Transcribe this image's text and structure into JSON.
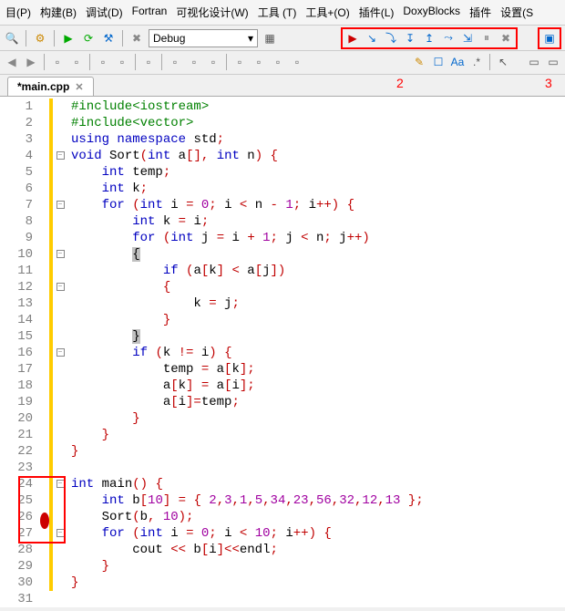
{
  "menu": {
    "items": [
      "目(P)",
      "构建(B)",
      "调试(D)",
      "Fortran",
      "可视化设计(W)",
      "工具 (T)",
      "工具+(O)",
      "插件(L)",
      "DoxyBlocks",
      "插件",
      "设置(S"
    ]
  },
  "toolbar1": {
    "config_label": "Debug",
    "config_dropdown_char": "▾"
  },
  "annotations": {
    "label2": "2",
    "label3": "3"
  },
  "tab": {
    "title": "*main.cpp",
    "close": "✕"
  },
  "code": {
    "lines": [
      {
        "n": 1,
        "change": true,
        "fold": "",
        "html": "<span class='pp'>#include&lt;iostream&gt;</span>"
      },
      {
        "n": 2,
        "change": true,
        "fold": "",
        "html": "<span class='pp'>#include&lt;vector&gt;</span>"
      },
      {
        "n": 3,
        "change": true,
        "fold": "",
        "html": "<span class='kw'>using</span> <span class='kw'>namespace</span> std<span class='op'>;</span>"
      },
      {
        "n": 4,
        "change": true,
        "fold": "box",
        "html": "<span class='kw'>void</span> Sort<span class='op'>(</span><span class='kw'>int</span> a<span class='op'>[],</span> <span class='kw'>int</span> n<span class='op'>)</span> <span class='op'>{</span>"
      },
      {
        "n": 5,
        "change": true,
        "fold": "",
        "html": "    <span class='kw'>int</span> temp<span class='op'>;</span>"
      },
      {
        "n": 6,
        "change": true,
        "fold": "",
        "html": "    <span class='kw'>int</span> k<span class='op'>;</span>"
      },
      {
        "n": 7,
        "change": true,
        "fold": "box",
        "html": "    <span class='kw'>for</span> <span class='op'>(</span><span class='kw'>int</span> i <span class='op'>=</span> <span class='num'>0</span><span class='op'>;</span> i <span class='op'>&lt;</span> n <span class='op'>-</span> <span class='num'>1</span><span class='op'>;</span> i<span class='op'>++)</span> <span class='op'>{</span>"
      },
      {
        "n": 8,
        "change": true,
        "fold": "",
        "html": "        <span class='kw'>int</span> k <span class='op'>=</span> i<span class='op'>;</span>"
      },
      {
        "n": 9,
        "change": true,
        "fold": "",
        "html": "        <span class='kw'>for</span> <span class='op'>(</span><span class='kw'>int</span> j <span class='op'>=</span> i <span class='op'>+</span> <span class='num'>1</span><span class='op'>;</span> j <span class='op'>&lt;</span> n<span class='op'>;</span> j<span class='op'>++)</span>"
      },
      {
        "n": 10,
        "change": true,
        "fold": "box",
        "html": "        <span class='curbrace'>{</span>"
      },
      {
        "n": 11,
        "change": true,
        "fold": "",
        "html": "            <span class='kw'>if</span> <span class='op'>(</span>a<span class='op'>[</span>k<span class='op'>]</span> <span class='op'>&lt;</span> a<span class='op'>[</span>j<span class='op'>])</span>"
      },
      {
        "n": 12,
        "change": true,
        "fold": "box",
        "html": "            <span class='op'>{</span>"
      },
      {
        "n": 13,
        "change": true,
        "fold": "",
        "html": "                k <span class='op'>=</span> j<span class='op'>;</span>"
      },
      {
        "n": 14,
        "change": true,
        "fold": "",
        "html": "            <span class='op'>}</span>"
      },
      {
        "n": 15,
        "change": true,
        "fold": "",
        "html": "        <span class='curbrace'>}</span>"
      },
      {
        "n": 16,
        "change": true,
        "fold": "box",
        "html": "        <span class='kw'>if</span> <span class='op'>(</span>k <span class='op'>!=</span> i<span class='op'>)</span> <span class='op'>{</span>"
      },
      {
        "n": 17,
        "change": true,
        "fold": "",
        "html": "            temp <span class='op'>=</span> a<span class='op'>[</span>k<span class='op'>];</span>"
      },
      {
        "n": 18,
        "change": true,
        "fold": "",
        "html": "            a<span class='op'>[</span>k<span class='op'>]</span> <span class='op'>=</span> a<span class='op'>[</span>i<span class='op'>];</span>"
      },
      {
        "n": 19,
        "change": true,
        "fold": "",
        "html": "            a<span class='op'>[</span>i<span class='op'>]=</span>temp<span class='op'>;</span>"
      },
      {
        "n": 20,
        "change": true,
        "fold": "",
        "html": "        <span class='op'>}</span>"
      },
      {
        "n": 21,
        "change": true,
        "fold": "",
        "html": "    <span class='op'>}</span>"
      },
      {
        "n": 22,
        "change": true,
        "fold": "",
        "html": "<span class='op'>}</span>"
      },
      {
        "n": 23,
        "change": true,
        "fold": "",
        "html": ""
      },
      {
        "n": 24,
        "change": true,
        "fold": "box",
        "html": "<span class='kw'>int</span> main<span class='op'>()</span> <span class='op'>{</span>"
      },
      {
        "n": 25,
        "change": true,
        "fold": "",
        "html": "    <span class='kw'>int</span> b<span class='op'>[</span><span class='num'>10</span><span class='op'>]</span> <span class='op'>=</span> <span class='op'>{</span> <span class='num'>2</span><span class='op'>,</span><span class='num'>3</span><span class='op'>,</span><span class='num'>1</span><span class='op'>,</span><span class='num'>5</span><span class='op'>,</span><span class='num'>34</span><span class='op'>,</span><span class='num'>23</span><span class='op'>,</span><span class='num'>56</span><span class='op'>,</span><span class='num'>32</span><span class='op'>,</span><span class='num'>12</span><span class='op'>,</span><span class='num'>13</span> <span class='op'>};</span>"
      },
      {
        "n": 26,
        "change": true,
        "fold": "",
        "bp": true,
        "html": "    Sort<span class='op'>(</span>b<span class='op'>,</span> <span class='num'>10</span><span class='op'>);</span>"
      },
      {
        "n": 27,
        "change": true,
        "fold": "box",
        "html": "    <span class='kw'>for</span> <span class='op'>(</span><span class='kw'>int</span> i <span class='op'>=</span> <span class='num'>0</span><span class='op'>;</span> i <span class='op'>&lt;</span> <span class='num'>10</span><span class='op'>;</span> i<span class='op'>++)</span> <span class='op'>{</span>"
      },
      {
        "n": 28,
        "change": true,
        "fold": "",
        "html": "        cout <span class='op'>&lt;&lt;</span> b<span class='op'>[</span>i<span class='op'>]&lt;&lt;</span>endl<span class='op'>;</span>"
      },
      {
        "n": 29,
        "change": true,
        "fold": "",
        "html": "    <span class='op'>}</span>"
      },
      {
        "n": 30,
        "change": true,
        "fold": "",
        "html": "<span class='op'>}</span>"
      },
      {
        "n": 31,
        "change": false,
        "fold": "",
        "html": ""
      }
    ]
  }
}
